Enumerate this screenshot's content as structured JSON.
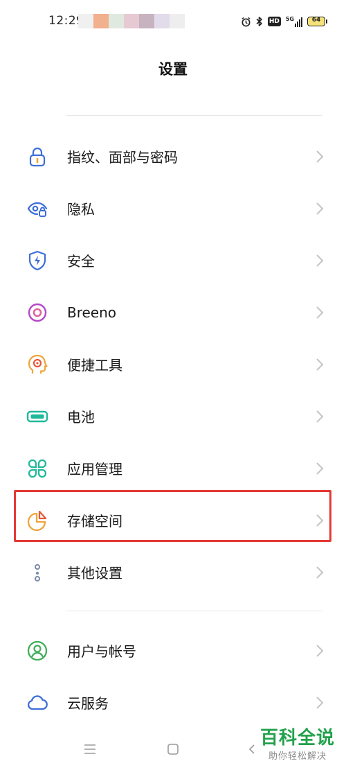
{
  "status_bar": {
    "time": "12:29",
    "signal_label": "5G",
    "battery_level": "64"
  },
  "header": {
    "title": "设置"
  },
  "menu": [
    {
      "label": "指纹、面部与密码",
      "icon": "lock-icon"
    },
    {
      "label": "隐私",
      "icon": "privacy-eye-icon"
    },
    {
      "label": "安全",
      "icon": "shield-icon"
    },
    {
      "label": "Breeno",
      "icon": "breeno-icon"
    },
    {
      "label": "便捷工具",
      "icon": "tools-head-icon"
    },
    {
      "label": "电池",
      "icon": "battery-icon"
    },
    {
      "label": "应用管理",
      "icon": "apps-grid-icon"
    },
    {
      "label": "存储空间",
      "icon": "storage-pie-icon"
    },
    {
      "label": "其他设置",
      "icon": "more-dots-icon"
    },
    {
      "label": "用户与帐号",
      "icon": "user-icon"
    },
    {
      "label": "云服务",
      "icon": "cloud-icon"
    }
  ],
  "highlighted_item": "存储空间",
  "watermark": {
    "title": "百科全说",
    "subtitle": "助你轻松解决"
  },
  "colors": {
    "highlight": "#e53935",
    "accent_blue": "#2f6fdf",
    "watermark_green": "#23a24d"
  }
}
